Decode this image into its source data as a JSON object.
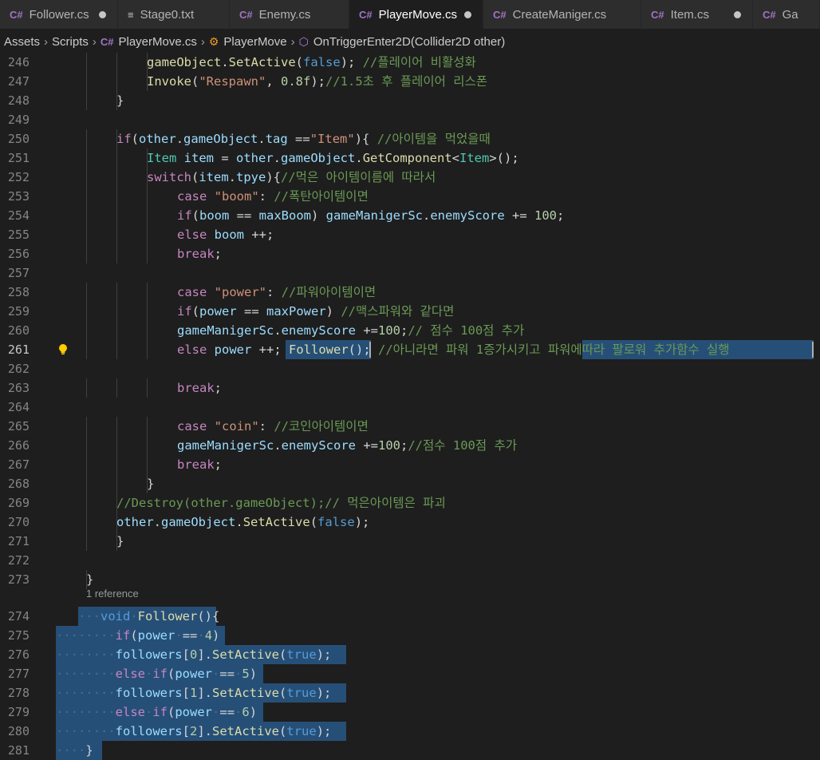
{
  "tabs": [
    {
      "label": "Follower.cs",
      "icon": "csharp-icon",
      "modified": true,
      "active": false
    },
    {
      "label": "Stage0.txt",
      "icon": "text-file-icon",
      "modified": false,
      "active": false
    },
    {
      "label": "Enemy.cs",
      "icon": "csharp-icon",
      "modified": false,
      "active": false
    },
    {
      "label": "PlayerMove.cs",
      "icon": "csharp-icon",
      "modified": true,
      "active": true
    },
    {
      "label": "CreateManiger.cs",
      "icon": "csharp-icon",
      "modified": false,
      "active": false
    },
    {
      "label": "Item.cs",
      "icon": "csharp-icon",
      "modified": true,
      "active": false
    },
    {
      "label": "Ga",
      "icon": "csharp-icon",
      "modified": false,
      "active": false
    }
  ],
  "breadcrumb": {
    "folder1": "Assets",
    "folder2": "Scripts",
    "file": "PlayerMove.cs",
    "cls": "PlayerMove",
    "method": "OnTriggerEnter2D(Collider2D other)"
  },
  "codelens": "1 reference",
  "colors": {
    "keyword": "#569cd6",
    "control": "#c586c0",
    "string": "#ce9178",
    "comment": "#6a9955",
    "number": "#b5cea8",
    "function": "#dcdcaa",
    "type": "#4ec9b0",
    "variable": "#9cdcfe",
    "selection": "#264f78"
  },
  "lines": [
    {
      "n": "246",
      "t": [
        [
          "fn",
          "gameObject"
        ],
        [
          "pl",
          "."
        ],
        [
          "fn",
          "SetActive"
        ],
        [
          "pl",
          "("
        ],
        [
          "kw",
          "false"
        ],
        [
          "pl",
          "); "
        ],
        [
          "cm",
          "//플레이어 비활성화"
        ]
      ]
    },
    {
      "n": "247",
      "t": [
        [
          "fn",
          "Invoke"
        ],
        [
          "pl",
          "("
        ],
        [
          "str",
          "\"Respawn\""
        ],
        [
          "pl",
          ", "
        ],
        [
          "num",
          "0.8f"
        ],
        [
          "pl",
          ");"
        ],
        [
          "cm",
          "//1.5초 후 플레이어 리스폰"
        ]
      ]
    },
    {
      "n": "248",
      "t": [
        [
          "pl",
          "}"
        ]
      ]
    },
    {
      "n": "249",
      "t": []
    },
    {
      "n": "250",
      "t": [
        [
          "ctl",
          "if"
        ],
        [
          "pl",
          "("
        ],
        [
          "var",
          "other"
        ],
        [
          "pl",
          "."
        ],
        [
          "var",
          "gameObject"
        ],
        [
          "pl",
          "."
        ],
        [
          "var",
          "tag"
        ],
        [
          "pl",
          " =="
        ],
        [
          "str",
          "\"Item\""
        ],
        [
          "pl",
          "){ "
        ],
        [
          "cm",
          "//아이템을 먹었을때"
        ]
      ]
    },
    {
      "n": "251",
      "t": [
        [
          "ty",
          "Item"
        ],
        [
          "pl",
          " "
        ],
        [
          "var",
          "item"
        ],
        [
          "pl",
          " = "
        ],
        [
          "var",
          "other"
        ],
        [
          "pl",
          "."
        ],
        [
          "var",
          "gameObject"
        ],
        [
          "pl",
          "."
        ],
        [
          "fn",
          "GetComponent"
        ],
        [
          "pl",
          "<"
        ],
        [
          "ty",
          "Item"
        ],
        [
          "pl",
          ">();"
        ]
      ]
    },
    {
      "n": "252",
      "t": [
        [
          "ctl",
          "switch"
        ],
        [
          "pl",
          "("
        ],
        [
          "var",
          "item"
        ],
        [
          "pl",
          "."
        ],
        [
          "var",
          "tpye"
        ],
        [
          "pl",
          "){"
        ],
        [
          "cm",
          "//먹은 아이템이름에 따라서"
        ]
      ]
    },
    {
      "n": "253",
      "t": [
        [
          "ctl",
          "case"
        ],
        [
          "pl",
          " "
        ],
        [
          "str",
          "\"boom\""
        ],
        [
          "pl",
          ": "
        ],
        [
          "cm",
          "//폭탄아이템이면"
        ]
      ]
    },
    {
      "n": "254",
      "t": [
        [
          "ctl",
          "if"
        ],
        [
          "pl",
          "("
        ],
        [
          "var",
          "boom"
        ],
        [
          "pl",
          " == "
        ],
        [
          "var",
          "maxBoom"
        ],
        [
          "pl",
          ") "
        ],
        [
          "var",
          "gameManigerSc"
        ],
        [
          "pl",
          "."
        ],
        [
          "var",
          "enemyScore"
        ],
        [
          "pl",
          " += "
        ],
        [
          "num",
          "100"
        ],
        [
          "pl",
          ";"
        ]
      ]
    },
    {
      "n": "255",
      "t": [
        [
          "ctl",
          "else"
        ],
        [
          "pl",
          " "
        ],
        [
          "var",
          "boom"
        ],
        [
          "pl",
          " ++;"
        ]
      ]
    },
    {
      "n": "256",
      "t": [
        [
          "ctl",
          "break"
        ],
        [
          "pl",
          ";"
        ]
      ]
    },
    {
      "n": "257",
      "t": []
    },
    {
      "n": "258",
      "t": [
        [
          "ctl",
          "case"
        ],
        [
          "pl",
          " "
        ],
        [
          "str",
          "\"power\""
        ],
        [
          "pl",
          ": "
        ],
        [
          "cm",
          "//파워아이템이면"
        ]
      ]
    },
    {
      "n": "259",
      "t": [
        [
          "ctl",
          "if"
        ],
        [
          "pl",
          "("
        ],
        [
          "var",
          "power"
        ],
        [
          "pl",
          " == "
        ],
        [
          "var",
          "maxPower"
        ],
        [
          "pl",
          ") "
        ],
        [
          "cm",
          "//맥스파워와 같다면"
        ]
      ]
    },
    {
      "n": "260",
      "t": [
        [
          "var",
          "gameManigerSc"
        ],
        [
          "pl",
          "."
        ],
        [
          "var",
          "enemyScore"
        ],
        [
          "pl",
          " +="
        ],
        [
          "num",
          "100"
        ],
        [
          "pl",
          ";"
        ],
        [
          "cm",
          "// 점수 100점 추가"
        ]
      ]
    },
    {
      "n": "261",
      "t": [
        [
          "ctl",
          "else"
        ],
        [
          "pl",
          " "
        ],
        [
          "var",
          "power"
        ],
        [
          "pl",
          " ++; "
        ],
        [
          "fn",
          "Follower"
        ],
        [
          "pl",
          "(); "
        ],
        [
          "cm",
          "//아니라면 파워 1증가시키고 파워에따라 팔로워 추가함수 실행"
        ]
      ]
    },
    {
      "n": "262",
      "t": []
    },
    {
      "n": "263",
      "t": [
        [
          "ctl",
          "break"
        ],
        [
          "pl",
          ";"
        ]
      ]
    },
    {
      "n": "264",
      "t": []
    },
    {
      "n": "265",
      "t": [
        [
          "ctl",
          "case"
        ],
        [
          "pl",
          " "
        ],
        [
          "str",
          "\"coin\""
        ],
        [
          "pl",
          ": "
        ],
        [
          "cm",
          "//코인아이템이면"
        ]
      ]
    },
    {
      "n": "266",
      "t": [
        [
          "var",
          "gameManigerSc"
        ],
        [
          "pl",
          "."
        ],
        [
          "var",
          "enemyScore"
        ],
        [
          "pl",
          " +="
        ],
        [
          "num",
          "100"
        ],
        [
          "pl",
          ";"
        ],
        [
          "cm",
          "//점수 100점 추가"
        ]
      ]
    },
    {
      "n": "267",
      "t": [
        [
          "ctl",
          "break"
        ],
        [
          "pl",
          ";"
        ]
      ]
    },
    {
      "n": "268",
      "t": [
        [
          "pl",
          "}"
        ]
      ]
    },
    {
      "n": "269",
      "t": [
        [
          "cm",
          "//Destroy(other.gameObject);// 먹은아이템은 파괴"
        ]
      ]
    },
    {
      "n": "270",
      "t": [
        [
          "var",
          "other"
        ],
        [
          "pl",
          "."
        ],
        [
          "var",
          "gameObject"
        ],
        [
          "pl",
          "."
        ],
        [
          "fn",
          "SetActive"
        ],
        [
          "pl",
          "("
        ],
        [
          "kw",
          "false"
        ],
        [
          "pl",
          ");"
        ]
      ]
    },
    {
      "n": "271",
      "t": [
        [
          "pl",
          "}"
        ]
      ]
    },
    {
      "n": "272",
      "t": []
    },
    {
      "n": "273",
      "t": [
        [
          "pl",
          "}"
        ]
      ]
    },
    {
      "n": "274",
      "t": [
        [
          "kw",
          "void"
        ],
        [
          "ws",
          "·"
        ],
        [
          "fn",
          "Follower"
        ],
        [
          "pl",
          "(){"
        ]
      ]
    },
    {
      "n": "275",
      "t": [
        [
          "ctl",
          "if"
        ],
        [
          "pl",
          "("
        ],
        [
          "var",
          "power"
        ],
        [
          "ws",
          "·"
        ],
        [
          "pl",
          "=="
        ],
        [
          "ws",
          "·"
        ],
        [
          "num",
          "4"
        ],
        [
          "pl",
          ")"
        ]
      ]
    },
    {
      "n": "276",
      "t": [
        [
          "var",
          "followers"
        ],
        [
          "pl",
          "["
        ],
        [
          "num",
          "0"
        ],
        [
          "pl",
          "]."
        ],
        [
          "fn",
          "SetActive"
        ],
        [
          "pl",
          "("
        ],
        [
          "kw",
          "true"
        ],
        [
          "pl",
          ");"
        ]
      ]
    },
    {
      "n": "277",
      "t": [
        [
          "ctl",
          "else"
        ],
        [
          "ws",
          "·"
        ],
        [
          "ctl",
          "if"
        ],
        [
          "pl",
          "("
        ],
        [
          "var",
          "power"
        ],
        [
          "ws",
          "·"
        ],
        [
          "pl",
          "=="
        ],
        [
          "ws",
          "·"
        ],
        [
          "num",
          "5"
        ],
        [
          "pl",
          ")"
        ]
      ]
    },
    {
      "n": "278",
      "t": [
        [
          "var",
          "followers"
        ],
        [
          "pl",
          "["
        ],
        [
          "num",
          "1"
        ],
        [
          "pl",
          "]."
        ],
        [
          "fn",
          "SetActive"
        ],
        [
          "pl",
          "("
        ],
        [
          "kw",
          "true"
        ],
        [
          "pl",
          ");"
        ]
      ]
    },
    {
      "n": "279",
      "t": [
        [
          "ctl",
          "else"
        ],
        [
          "ws",
          "·"
        ],
        [
          "ctl",
          "if"
        ],
        [
          "pl",
          "("
        ],
        [
          "var",
          "power"
        ],
        [
          "ws",
          "·"
        ],
        [
          "pl",
          "=="
        ],
        [
          "ws",
          "·"
        ],
        [
          "num",
          "6"
        ],
        [
          "pl",
          ")"
        ]
      ]
    },
    {
      "n": "280",
      "t": [
        [
          "var",
          "followers"
        ],
        [
          "pl",
          "["
        ],
        [
          "num",
          "2"
        ],
        [
          "pl",
          "]."
        ],
        [
          "fn",
          "SetActive"
        ],
        [
          "pl",
          "("
        ],
        [
          "kw",
          "true"
        ],
        [
          "pl",
          ");"
        ]
      ]
    },
    {
      "n": "281",
      "t": [
        [
          "pl",
          "}"
        ]
      ]
    }
  ]
}
